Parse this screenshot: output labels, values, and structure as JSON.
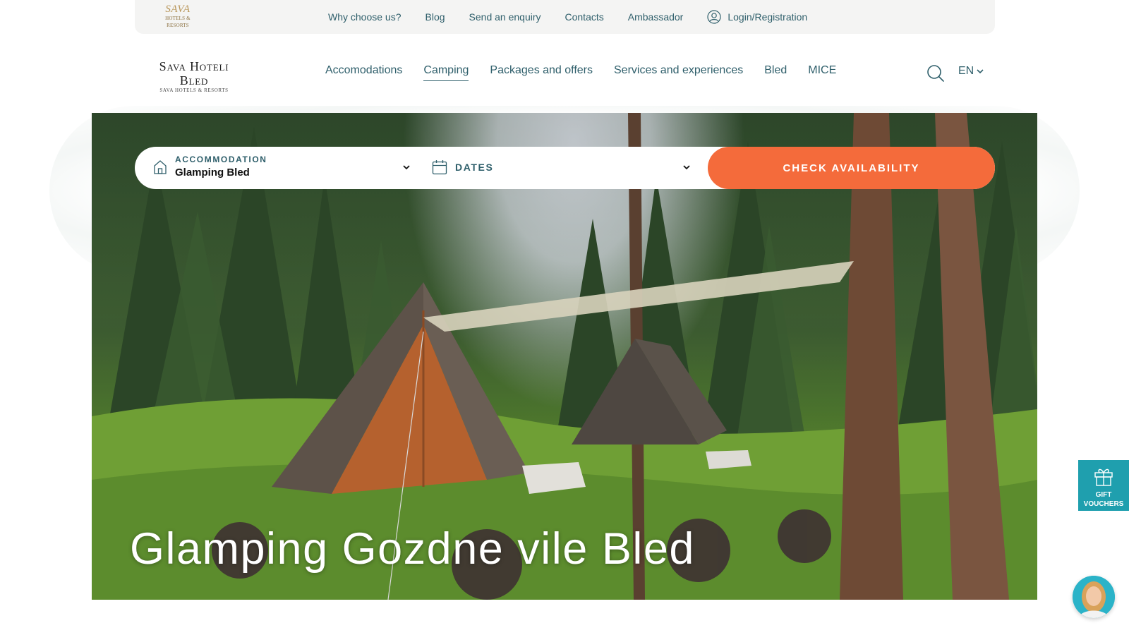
{
  "top_bar": {
    "logo_text": "SAVA",
    "logo_subtext": "HOTELS & RESORTS",
    "links": [
      {
        "label": "Why choose us?"
      },
      {
        "label": "Blog"
      },
      {
        "label": "Send an enquiry"
      },
      {
        "label": "Contacts"
      },
      {
        "label": "Ambassador"
      }
    ],
    "login_label": "Login/Registration",
    "login_icon": "user-icon"
  },
  "main_nav": {
    "brand_name": "Sava Hoteli Bled",
    "brand_subtext": "SAVA HOTELS & RESORTS",
    "items": [
      {
        "label": "Accomodations",
        "active": false
      },
      {
        "label": "Camping",
        "active": true
      },
      {
        "label": "Packages and offers",
        "active": false
      },
      {
        "label": "Services and experiences",
        "active": false
      },
      {
        "label": "Bled",
        "active": false
      },
      {
        "label": "MICE",
        "active": false
      }
    ],
    "search_icon": "search-icon",
    "language": "EN"
  },
  "booking": {
    "accommodation_label": "ACCOMMODATION",
    "accommodation_value": "Glamping Bled",
    "accommodation_icon": "home-icon",
    "dates_label": "DATES",
    "dates_icon": "calendar-icon",
    "button_label": "CHECK AVAILABILITY",
    "button_color": "#f46b3b"
  },
  "hero": {
    "title": "Glamping Gozdne vile Bled"
  },
  "gift_vouchers": {
    "label_line1": "GIFT",
    "label_line2": "VOUCHERS",
    "icon": "gift-icon",
    "color": "#1f9fae"
  },
  "chat": {
    "icon": "chat-avatar-icon"
  },
  "colors": {
    "text_primary": "#2f5f6b",
    "accent_orange": "#f46b3b",
    "accent_teal": "#1f9fae"
  }
}
